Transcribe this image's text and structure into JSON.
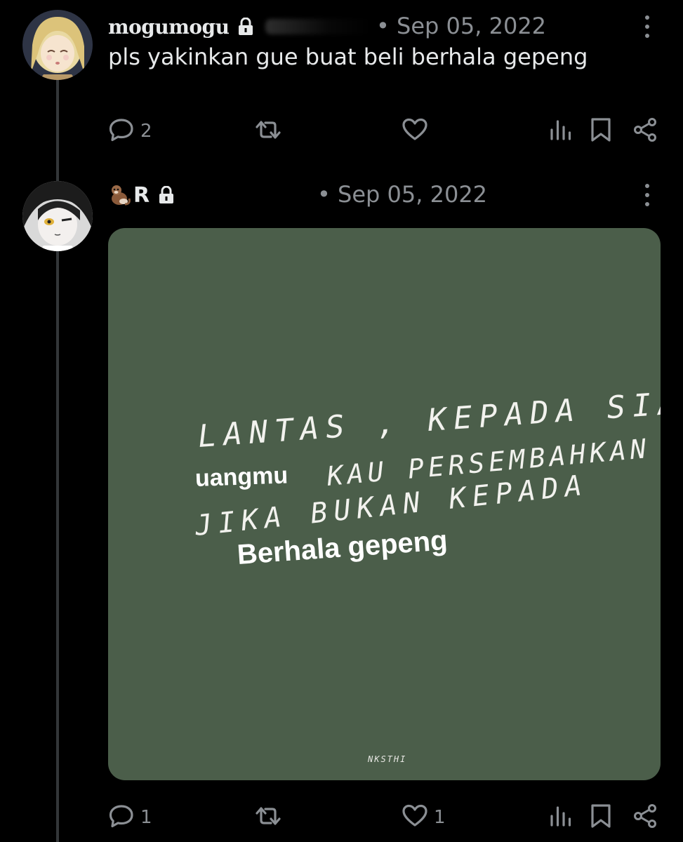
{
  "posts": [
    {
      "username": "mogumogu",
      "date": "• Sep 05, 2022",
      "text": "pls yakinkan gue buat beli berhala gepeng",
      "replies": "2",
      "likes": ""
    },
    {
      "username": "R",
      "date": "• Sep 05, 2022",
      "replies": "1",
      "likes": "1",
      "media": {
        "line1": "LANTAS , KEPADA SIAPA",
        "line2a": "uangmu",
        "line2b": "KAU PERSEMBAHKAN",
        "line3": "JIKA BUKAN KEPADA",
        "line4": "Berhala gepeng",
        "signature": "NKSTHI",
        "background_color": "#4b5e4a"
      }
    }
  ],
  "icons": {
    "lock": "lock-icon",
    "more": "more-vertical-icon",
    "reply": "reply-icon",
    "repost": "repost-icon",
    "like": "heart-icon",
    "views": "views-icon",
    "bookmark": "bookmark-icon",
    "share": "share-icon",
    "emoji": "otter-emoji-icon"
  },
  "colors": {
    "background": "#000000",
    "text": "#e7e9ea",
    "muted": "#8b8f94",
    "thread_line": "#333639"
  }
}
